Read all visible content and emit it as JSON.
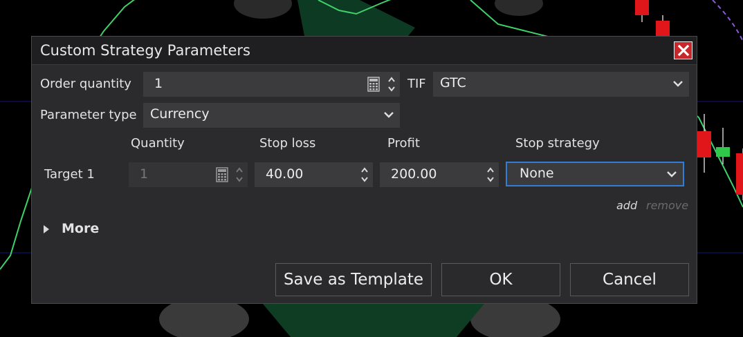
{
  "dialog": {
    "title": "Custom Strategy Parameters",
    "close_icon": "close-icon"
  },
  "order_quantity": {
    "label": "Order quantity",
    "value": "1"
  },
  "tif": {
    "label": "TIF",
    "value": "GTC"
  },
  "parameter_type": {
    "label": "Parameter type",
    "value": "Currency"
  },
  "columns": {
    "quantity": "Quantity",
    "stop_loss": "Stop loss",
    "profit": "Profit",
    "stop_strategy": "Stop strategy"
  },
  "target": {
    "label": "Target 1",
    "quantity": "1",
    "stop_loss": "40.00",
    "profit": "200.00",
    "stop_strategy": "None"
  },
  "links": {
    "add": "add",
    "remove": "remove"
  },
  "more": {
    "label": "More"
  },
  "buttons": {
    "save_template": "Save as Template",
    "ok": "OK",
    "cancel": "Cancel"
  },
  "colors": {
    "accent_focus": "#2f7fd8",
    "close_red": "#c8282b",
    "candle_red": "#e0161b",
    "candle_green": "#2fc84a",
    "chart_line": "#3fd16a"
  }
}
